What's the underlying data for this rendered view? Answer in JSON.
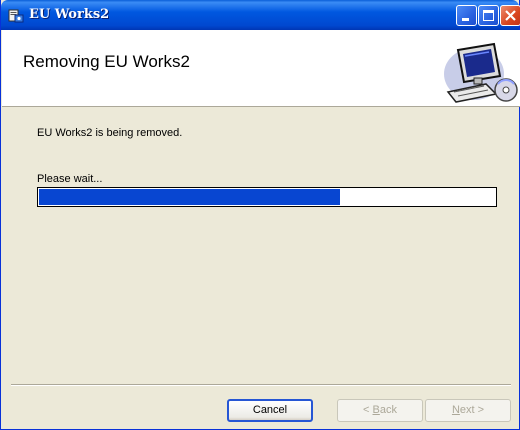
{
  "window": {
    "title": "EU Works2",
    "icon": "installer-icon",
    "controls": [
      "minimize-icon",
      "maximize-icon",
      "close-icon"
    ]
  },
  "header": {
    "title": "Removing EU Works2",
    "graphic": "computer-setup-icon"
  },
  "status": {
    "message": "EU Works2 is being removed.",
    "wait_label": "Please wait...",
    "progress": 0.66
  },
  "buttons": {
    "cancel": "Cancel",
    "back_underlined": "B",
    "back_rest": "ack",
    "back_prefix": "< ",
    "next_underlined": "N",
    "next_rest": "ext",
    "next_suffix": " >"
  },
  "colors": {
    "title_bar": "#0058e0",
    "progress_fill": "#0846d1",
    "close_button": "#d9451f"
  }
}
